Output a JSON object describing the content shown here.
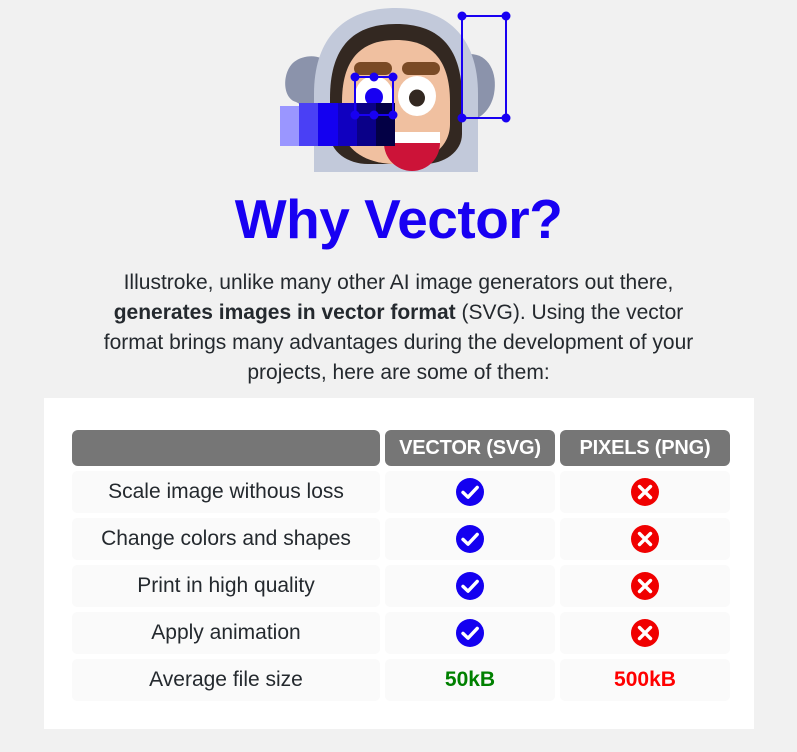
{
  "page": {
    "background_color": "#f1f1f1",
    "title": "Why Vector?",
    "title_color": "#1800f2"
  },
  "illustration": {
    "name": "astronaut-vector-editing-illustration",
    "description": "Astronaut face in helmet with vector selection handles and a blue color gradient bar",
    "colors": {
      "helmet": "#c2c9da",
      "ear": "#8b93ab",
      "hair": "#332821",
      "skin": "#f0c0a0",
      "eyebrow": "#7a4a25",
      "eye_white": "#ffffff",
      "pupil_right": "#332821",
      "pupil_left": "#1800f2",
      "mouth": "#cc1338",
      "teeth": "#ffffff",
      "handle": "#1800f2"
    },
    "gradient_swatches": [
      "#9a96ff",
      "#4a40f5",
      "#1400f0",
      "#1000c0",
      "#0a0088",
      "#030045"
    ]
  },
  "intro": {
    "line1_prefix": "Illustroke, unlike many other AI image generators out there, ",
    "bold": "generates images in vector format",
    "line1_suffix": " (SVG). Using the vector format brings many advantages during the development of your projects, here are some of them:"
  },
  "table": {
    "headers": {
      "label": "",
      "vector": "VECTOR (SVG)",
      "pixels": "PIXELS (PNG)"
    },
    "header_bg": "#767676",
    "rows": [
      {
        "label": "Scale image withous loss",
        "vector": "check",
        "pixels": "cross"
      },
      {
        "label": "Change colors and shapes",
        "vector": "check",
        "pixels": "cross"
      },
      {
        "label": "Print in high quality",
        "vector": "check",
        "pixels": "cross"
      },
      {
        "label": "Apply animation",
        "vector": "check",
        "pixels": "cross"
      },
      {
        "label": "Average file size",
        "vector": "50kB",
        "pixels": "500kB"
      }
    ],
    "icons": {
      "check": "check-circle-icon",
      "cross": "cross-circle-icon"
    },
    "icon_colors": {
      "check": "#1400f0",
      "cross": "#f00000"
    },
    "value_colors": {
      "good": "#008000",
      "bad": "#ff0000"
    }
  }
}
